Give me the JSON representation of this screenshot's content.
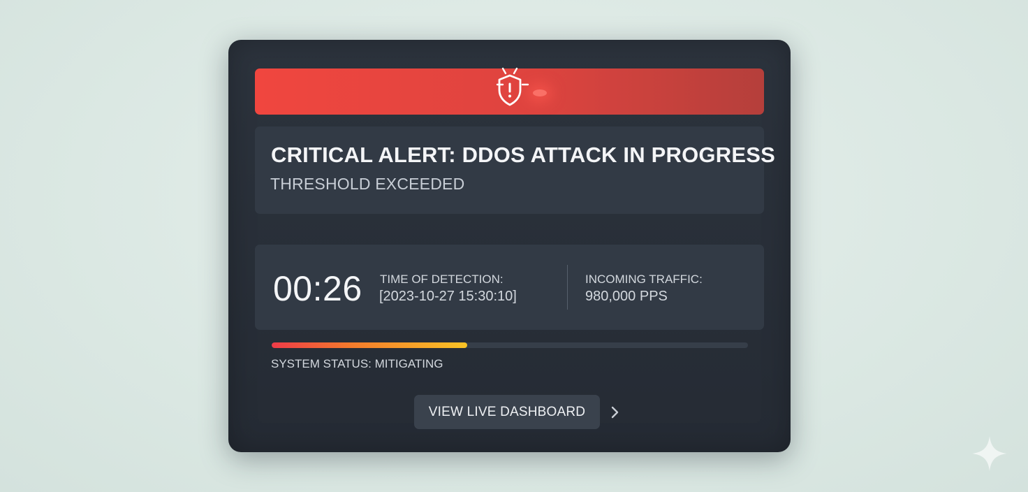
{
  "alert": {
    "icon": "shield-alert-icon",
    "title": "CRITICAL ALERT: DDOS ATTACK IN PROGRESS",
    "subtitle": "THRESHOLD EXCEEDED"
  },
  "stats": {
    "timer": "00:26",
    "detection_label": "TIME OF DETECTION:",
    "detection_value": "[2023-10-27 15:30:10]",
    "traffic_label": "INCOMING TRAFFIC:",
    "traffic_value": "980,000 PPS"
  },
  "status": {
    "progress_fraction": 0.41,
    "text": "SYSTEM STATUS: MITIGATING"
  },
  "action": {
    "button_label": "VIEW LIVE DASHBOARD",
    "chevron_icon": "chevron-right-icon"
  },
  "colors": {
    "banner": "#f0463f",
    "card": "#2a313b",
    "panel": "#323a45",
    "progress_start": "#ef3b48",
    "progress_end": "#f9c325"
  }
}
